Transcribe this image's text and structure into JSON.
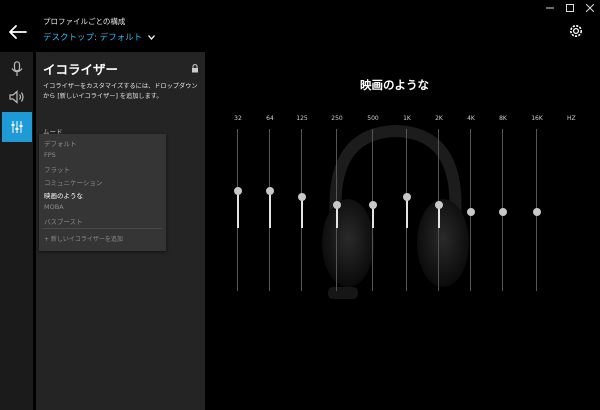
{
  "header": {
    "profile_label": "プロファイルごとの構成",
    "profile_selected": "デスクトップ: デフォルト"
  },
  "rail": {
    "items": [
      "microphone",
      "speaker",
      "equalizer"
    ],
    "active": "equalizer"
  },
  "panel": {
    "title": "イコライザー",
    "description": "イコライザーをカスタマイズするには、ドロップダウンから [新しいイコライザー] を追加します。",
    "mode_label": "ムード",
    "options": [
      "デフォルト",
      "FPS",
      "フラット",
      "コミュニケーション",
      "映画のような",
      "MOBA",
      "バスブースト"
    ],
    "selected_option": "映画のような",
    "add_new": "+ 新しいイコライザーを追加"
  },
  "equalizer": {
    "preset_title": "映画のような",
    "unit_label": "HZ",
    "bands": [
      {
        "label": "32",
        "level": 0.62
      },
      {
        "label": "64",
        "level": 0.62
      },
      {
        "label": "125",
        "level": 0.58
      },
      {
        "label": "250",
        "level": 0.53
      },
      {
        "label": "500",
        "level": 0.53
      },
      {
        "label": "1K",
        "level": 0.58
      },
      {
        "label": "2K",
        "level": 0.53
      },
      {
        "label": "4K",
        "level": 0.49
      },
      {
        "label": "8K",
        "level": 0.49
      },
      {
        "label": "16K",
        "level": 0.49
      }
    ]
  },
  "colors": {
    "accent": "#1e9ad6",
    "link": "#3db5ec"
  }
}
